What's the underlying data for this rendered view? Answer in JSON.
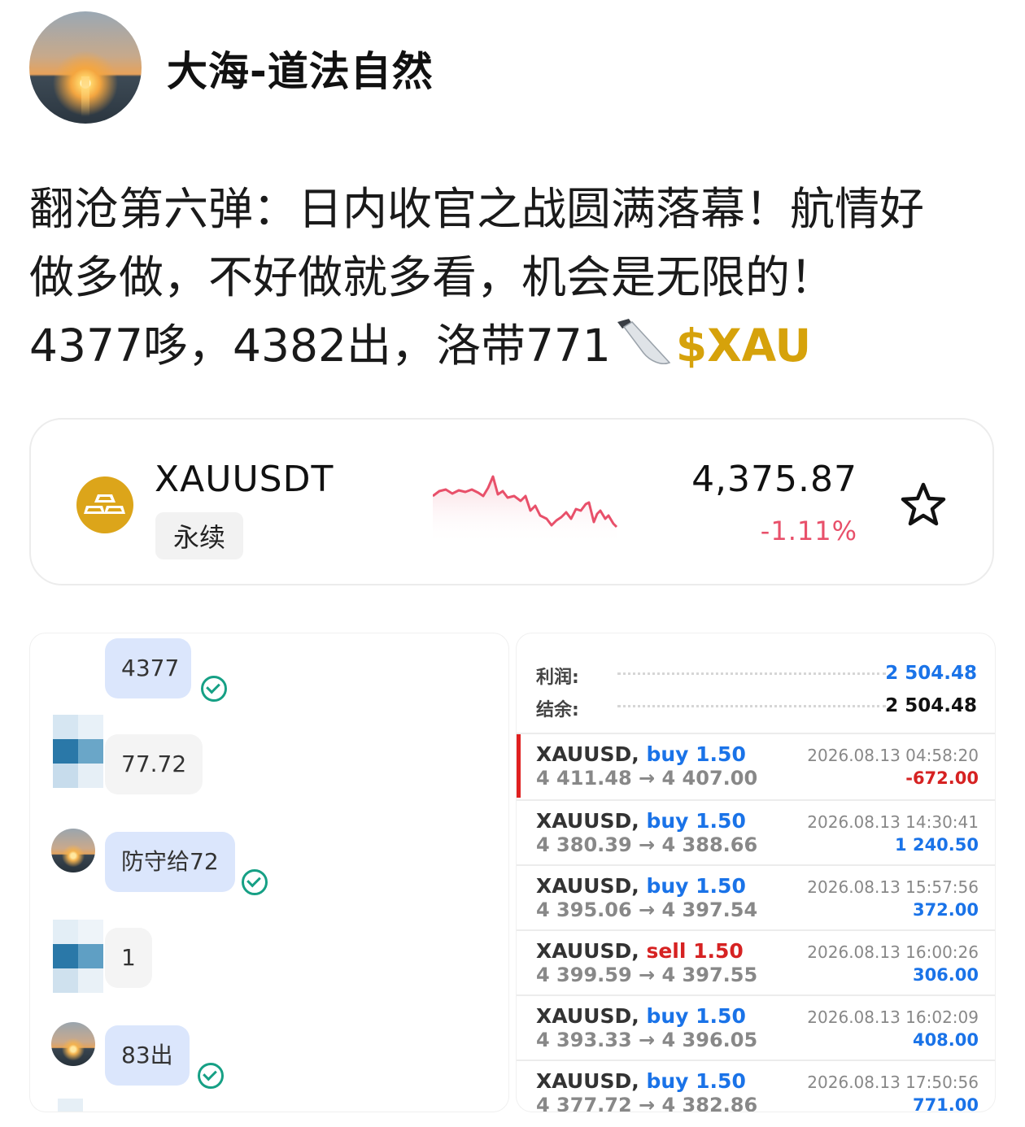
{
  "post": {
    "author": "大海-道法自然",
    "line1": "翻沧第六弹：日内收官之战圆满落幕！航情好",
    "line2": "做多做，不好做就多看，机会是无限的！",
    "line3": "4377哆，4382出，洛带771",
    "knife_icon": "kitchen-knife-emoji",
    "tag": "$XAU"
  },
  "ticker": {
    "symbol": "XAUUSDT",
    "badge": "永续",
    "price": "4,375.87",
    "change": "-1.11%",
    "coin_icon": "gold-bars-icon",
    "star_icon": "star-outline-icon",
    "colors": {
      "negative": "#e8506a",
      "coin": "#dca51a",
      "tag": "#d6a20b"
    }
  },
  "chat": {
    "messages": [
      {
        "text": "4377",
        "confirmed": true
      },
      {
        "text": "77.72",
        "confirmed": false
      },
      {
        "text": "防守给72",
        "confirmed": true
      },
      {
        "text": "1",
        "confirmed": false
      },
      {
        "text": "83出",
        "confirmed": true
      }
    ]
  },
  "account": {
    "profit_label": "利润:",
    "profit_value": "2 504.48",
    "balance_label": "结余:",
    "balance_value": "2 504.48",
    "trades": [
      {
        "symbol": "XAUUSD,",
        "side": "buy",
        "lots": "1.50",
        "open": "4 411.48",
        "arrow": "→",
        "close": "4 407.00",
        "time": "2026.08.13 04:58:20",
        "pnl": "-672.00"
      },
      {
        "symbol": "XAUUSD,",
        "side": "buy",
        "lots": "1.50",
        "open": "4 380.39",
        "arrow": "→",
        "close": "4 388.66",
        "time": "2026.08.13 14:30:41",
        "pnl": "1 240.50"
      },
      {
        "symbol": "XAUUSD,",
        "side": "buy",
        "lots": "1.50",
        "open": "4 395.06",
        "arrow": "→",
        "close": "4 397.54",
        "time": "2026.08.13 15:57:56",
        "pnl": "372.00"
      },
      {
        "symbol": "XAUUSD,",
        "side": "sell",
        "lots": "1.50",
        "open": "4 399.59",
        "arrow": "→",
        "close": "4 397.55",
        "time": "2026.08.13 16:00:26",
        "pnl": "306.00"
      },
      {
        "symbol": "XAUUSD,",
        "side": "buy",
        "lots": "1.50",
        "open": "4 393.33",
        "arrow": "→",
        "close": "4 396.05",
        "time": "2026.08.13 16:02:09",
        "pnl": "408.00"
      },
      {
        "symbol": "XAUUSD,",
        "side": "buy",
        "lots": "1.50",
        "open": "4 377.72",
        "arrow": "→",
        "close": "4 382.86",
        "time": "2026.08.13 17:50:56",
        "pnl": "771.00"
      }
    ]
  }
}
